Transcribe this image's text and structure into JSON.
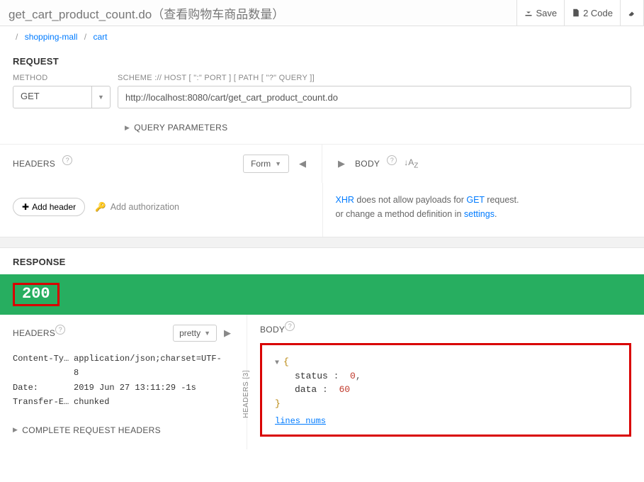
{
  "top": {
    "title": "get_cart_product_count.do（查看购物车商品数量）",
    "save": "Save",
    "code": "2 Code"
  },
  "breadcrumb": {
    "root": "/",
    "p1": "shopping-mall",
    "p2": "cart"
  },
  "request": {
    "title": "REQUEST",
    "method_label": "METHOD",
    "method_value": "GET",
    "scheme_label": "SCHEME :// HOST [ \":\" PORT ] [ PATH [ \"?\" QUERY ]]",
    "url": "http://localhost:8080/cart/get_cart_product_count.do",
    "query_params": "QUERY PARAMETERS",
    "headers_label": "HEADERS",
    "form_label": "Form",
    "body_label": "BODY",
    "add_header": "Add header",
    "add_auth": "Add authorization",
    "body_msg1a": "XHR",
    "body_msg1b": " does not allow payloads for ",
    "body_msg1c": "GET",
    "body_msg1d": " request.",
    "body_msg2a": "or change a method definition in ",
    "body_msg2b": "settings",
    "body_msg2c": "."
  },
  "response": {
    "title": "RESPONSE",
    "status": "200",
    "headers_label": "HEADERS",
    "pretty": "pretty",
    "rot_label": "HEADERS [3]",
    "headers": [
      {
        "k": "Content-Typ…",
        "v": "application/json;charset=UTF-8"
      },
      {
        "k": "Date:",
        "v": "2019 Jun 27 13:11:29 -1s"
      },
      {
        "k": "Transfer-En…",
        "v": "chunked"
      }
    ],
    "complete": "COMPLETE REQUEST HEADERS",
    "body_label": "BODY",
    "json": {
      "status_key": "status",
      "status_val": "0",
      "data_key": "data",
      "data_val": "60"
    },
    "lines": "lines nums"
  }
}
